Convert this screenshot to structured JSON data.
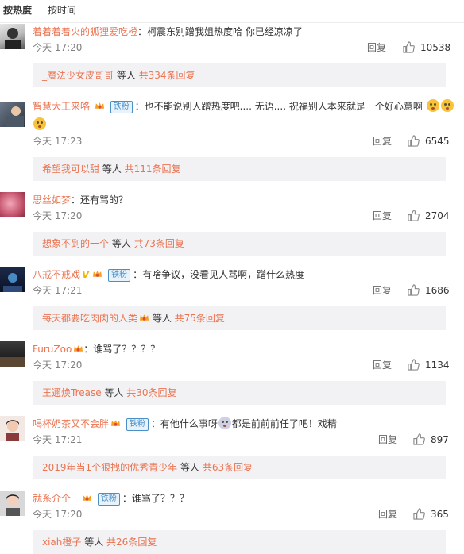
{
  "tabs": [
    {
      "label": "按热度"
    },
    {
      "label": "按时间"
    }
  ],
  "comments": [
    {
      "username": "着着着着火的狐狸爱吃橙",
      "text": "：柯震东别蹭我姐热度哈 你已经凉凉了",
      "time": "今天 17:20",
      "reply": "回复",
      "likes": "10538",
      "replybox": {
        "user": "_魔法少女皮哥哥",
        "mid": " 等人 ",
        "count": "共334条回复"
      }
    },
    {
      "username": "智慧大王来咯",
      "fan": "铁粉",
      "text": "：也不能说别人蹭热度吧.... 无语.... 祝福别人本来就是一个好心意啊",
      "time": "今天 17:23",
      "reply": "回复",
      "likes": "6545",
      "replybox": {
        "user": "希望我可以甜",
        "mid": " 等人 ",
        "count": "共111条回复"
      }
    },
    {
      "username": "思丝如梦",
      "text": "：还有骂的？",
      "time": "今天 17:20",
      "reply": "回复",
      "likes": "2704",
      "replybox": {
        "user": "想象不到的一个",
        "mid": " 等人 ",
        "count": "共73条回复"
      }
    },
    {
      "username": "八戒不戒戏",
      "fan": "铁粉",
      "text": "：有啥争议，没看见人骂啊，蹭什么热度",
      "time": "今天 17:21",
      "reply": "回复",
      "likes": "1686",
      "replybox": {
        "user": "每天都要吃肉肉的人类",
        "mid": " 等人 ",
        "count": "共75条回复"
      }
    },
    {
      "username": "FuruZoo",
      "text": "：谁骂了？？？？",
      "time": "今天 17:20",
      "reply": "回复",
      "likes": "1134",
      "replybox": {
        "user": "王邇焕Trease",
        "mid": " 等人 ",
        "count": "共30条回复"
      }
    },
    {
      "username": "喝杯奶茶又不会胖",
      "fan": "铁粉",
      "text": "：有他什么事呀",
      "text2": "都是前前前任了吧！戏精",
      "time": "今天 17:21",
      "reply": "回复",
      "likes": "897",
      "replybox": {
        "user": "2019年当1个狠拽的优秀青少年",
        "mid": " 等人 ",
        "count": "共63条回复"
      }
    },
    {
      "username": "就系介个一",
      "fan": "铁粉",
      "text": "：谁骂了？？？",
      "time": "今天 17:20",
      "reply": "回复",
      "likes": "365",
      "replybox": {
        "user": "xiah橙子",
        "mid": " 等人 ",
        "count": "共26条回复"
      }
    }
  ],
  "colors": {
    "username": "#eb7350",
    "fan_badge": "#4a90c7",
    "reply_bg": "#f2f2f5",
    "time": "#808080"
  }
}
